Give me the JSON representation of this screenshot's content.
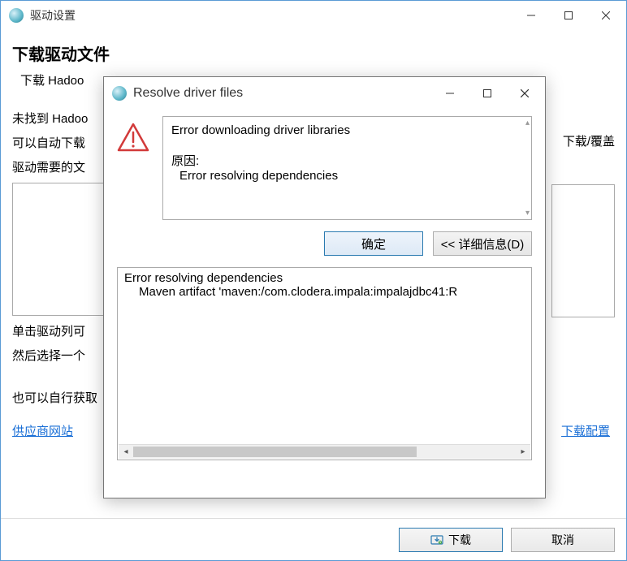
{
  "mainWindow": {
    "title": "驱动设置",
    "heading": "下载驱动文件",
    "subheading": "下载 Hadoo",
    "body_line1": "未找到 Hadoo",
    "body_line2": "可以自动下载",
    "body_line3": "驱动需要的文",
    "hint_line1": "单击驱动列可",
    "hint_line2": "然后选择一个",
    "self_line": "也可以自行获取",
    "right_label": "下载/覆盖",
    "vendor_link": "供应商网站",
    "download_config_link": "下载配置",
    "download_btn": "下载",
    "cancel_btn": "取消"
  },
  "modal": {
    "title": "Resolve driver files",
    "error_title": "Error downloading driver libraries",
    "reason_label": "原因:",
    "reason_text": "Error resolving dependencies",
    "ok_btn": "确定",
    "details_btn": "<< 详细信息(D)",
    "details_line1": "Error resolving dependencies",
    "details_line2": "Maven artifact 'maven:/com.clodera.impala:impalajdbc41:R"
  }
}
